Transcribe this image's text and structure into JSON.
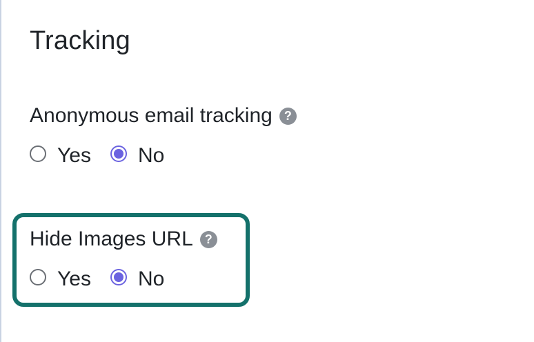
{
  "section": {
    "title": "Tracking"
  },
  "fields": [
    {
      "label": "Anonymous email tracking",
      "help_icon": "?",
      "options": [
        {
          "label": "Yes",
          "checked": false
        },
        {
          "label": "No",
          "checked": true
        }
      ]
    },
    {
      "label": "Hide Images URL",
      "help_icon": "?",
      "highlighted": true,
      "options": [
        {
          "label": "Yes",
          "checked": false
        },
        {
          "label": "No",
          "checked": true
        }
      ]
    }
  ],
  "colors": {
    "radio_accent": "#6b63e0",
    "highlight_border": "#14716b",
    "help_icon_bg": "#8a8f96"
  }
}
